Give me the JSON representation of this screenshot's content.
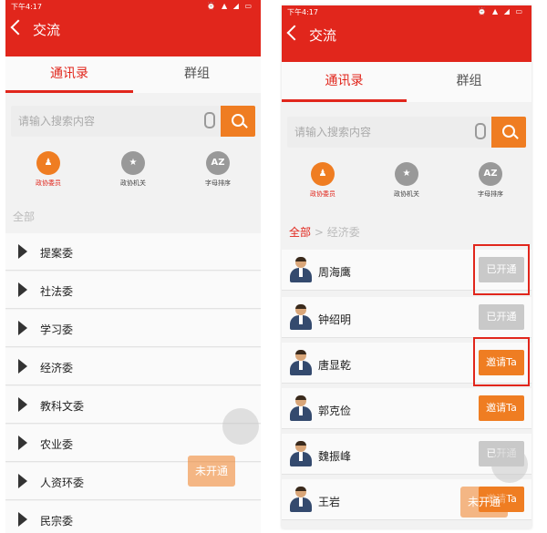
{
  "screen_left": {
    "status_time": "下午4:17",
    "status_icons": "⏰ ▲ ◢ ▭",
    "title": "交流",
    "tabs": [
      "通讯录",
      "群组"
    ],
    "search_placeholder": "请输入搜索内容",
    "categories": [
      {
        "label": "政协委员",
        "icon_text": "",
        "active": true
      },
      {
        "label": "政协机关",
        "icon_text": "★",
        "active": false
      },
      {
        "label": "字母排序",
        "icon_text": "AZ",
        "active": false
      }
    ],
    "section_label": "全部",
    "groups": [
      "提案委",
      "社法委",
      "学习委",
      "经济委",
      "教科文委",
      "农业委",
      "人资环委",
      "民宗委"
    ],
    "float_button": "未开通"
  },
  "screen_right": {
    "status_time": "下午4:17",
    "status_icons": "⏰ ▲ ◢ ▭",
    "title": "交流",
    "tabs": [
      "通讯录",
      "群组"
    ],
    "search_placeholder": "请输入搜索内容",
    "categories": [
      {
        "label": "政协委员",
        "icon_text": "",
        "active": true
      },
      {
        "label": "政协机关",
        "icon_text": "★",
        "active": false
      },
      {
        "label": "字母排序",
        "icon_text": "AZ",
        "active": false
      }
    ],
    "breadcrumb": {
      "root": "全部",
      "sep": " > ",
      "current": "经济委"
    },
    "members": [
      {
        "name": "周海鹰",
        "status": "已开通",
        "type": "gray",
        "highlighted": true
      },
      {
        "name": "钟绍明",
        "status": "已开通",
        "type": "gray",
        "highlighted": false
      },
      {
        "name": "唐显乾",
        "status": "邀请Ta",
        "type": "orange",
        "highlighted": true
      },
      {
        "name": "郭克俭",
        "status": "邀请Ta",
        "type": "orange",
        "highlighted": false
      },
      {
        "name": "魏振峰",
        "status": "已开通",
        "type": "gray",
        "highlighted": false
      },
      {
        "name": "王岩",
        "status": "邀请Ta",
        "type": "orange",
        "highlighted": false
      }
    ],
    "float_button": "未开通"
  },
  "colors": {
    "primary_red": "#e1261c",
    "accent_orange": "#ef7d22",
    "disabled_gray": "#c9c9c9"
  }
}
